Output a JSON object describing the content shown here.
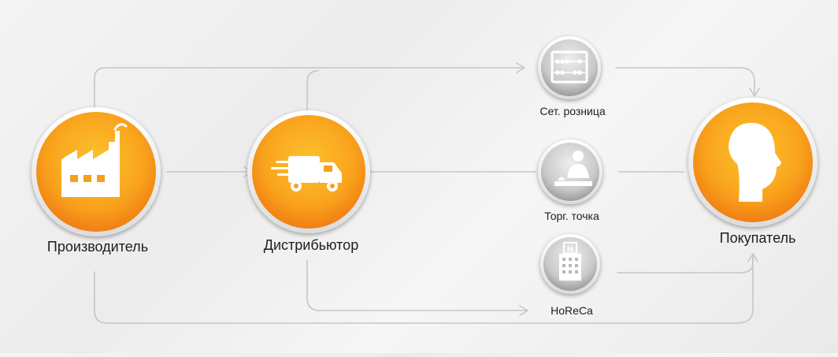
{
  "colors": {
    "orange_light": "#fcc22c",
    "orange_dark": "#f07f12",
    "gray_light": "#e4e4e4",
    "gray_dark": "#9c9c9c",
    "line": "#c6c6c6"
  },
  "nodes": {
    "producer": {
      "label": "Производитель",
      "icon": "factory-icon"
    },
    "distributor": {
      "label": "Дистрибьютор",
      "icon": "truck-icon"
    },
    "retail_chain": {
      "label": "Сет. розница",
      "icon": "abacus-icon"
    },
    "retail_point": {
      "label": "Торг. точка",
      "icon": "store-clerk-icon"
    },
    "horeca": {
      "label": "HoReCa",
      "icon": "hotel-building-icon"
    },
    "buyer": {
      "label": "Покупатель",
      "icon": "head-profile-icon"
    }
  }
}
